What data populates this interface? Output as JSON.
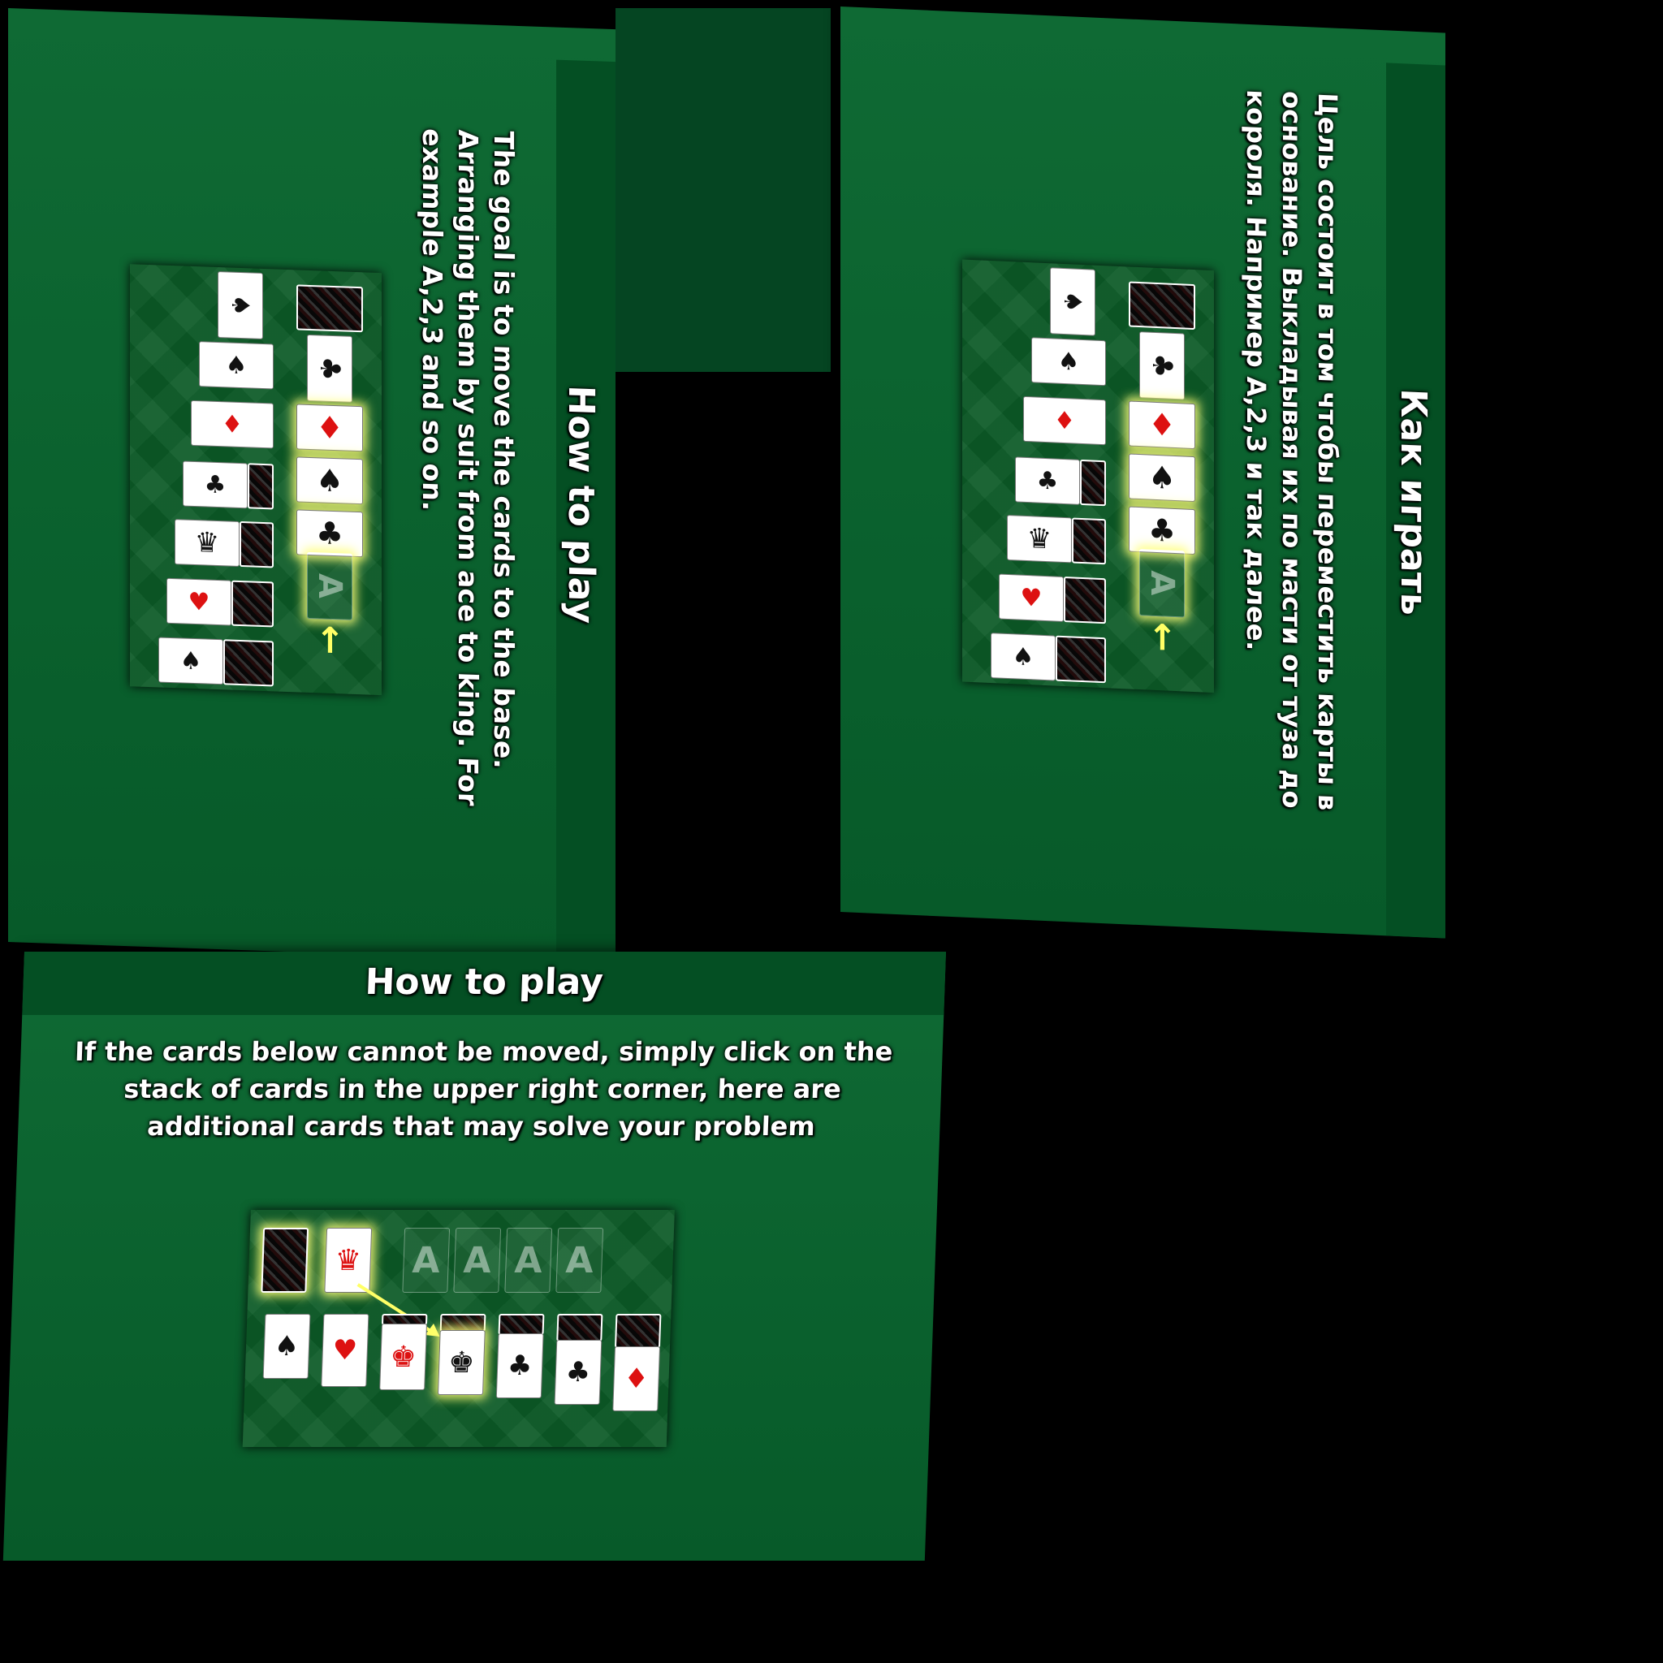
{
  "panel_en": {
    "title": "How to play",
    "body": "The goal is to move the cards to the base. Arranging them by suit from ace to king. For example A,2,3 and so on."
  },
  "panel_ru": {
    "title": "Как играть",
    "body": "Цель состоит в том чтобы переместить карты в основание. Выкладывая их по масти от туза до короля. Например А,2,3 и так далее."
  },
  "panel_stock": {
    "title": "How to play",
    "body": "If the cards below cannot be moved, simply click on the stack of cards in the upper right corner, here are additional cards that may solve your problem"
  },
  "illustration_vertical": {
    "empty_slot_label": "A",
    "arrow": "↑",
    "foundation": [
      {
        "glyph": "♦",
        "suit": "red"
      },
      {
        "glyph": "♠",
        "suit": "black"
      },
      {
        "glyph": "♣",
        "suit": "black"
      }
    ],
    "stock_top": {
      "glyph": "♣",
      "suit": "black"
    },
    "tableau": [
      {
        "glyph": "♠",
        "suit": "black"
      },
      {
        "glyph": "♠",
        "suit": "black"
      },
      {
        "glyph": "♦",
        "suit": "red"
      },
      {
        "glyph": "♣",
        "suit": "black"
      },
      {
        "glyph": "♛",
        "suit": "black"
      },
      {
        "glyph": "♥",
        "suit": "red"
      },
      {
        "glyph": "♠",
        "suit": "black"
      }
    ]
  },
  "illustration_horizontal": {
    "foundation_labels": [
      "A",
      "A",
      "A",
      "A"
    ],
    "waste": {
      "glyph": "♛",
      "suit": "red"
    },
    "tableau": [
      {
        "glyph": "♠",
        "suit": "black"
      },
      {
        "glyph": "♥",
        "suit": "red"
      },
      {
        "glyph": "♚",
        "suit": "red"
      },
      {
        "glyph": "♚",
        "suit": "black"
      },
      {
        "glyph": "♣",
        "suit": "black"
      },
      {
        "glyph": "♣",
        "suit": "black"
      },
      {
        "glyph": "♦",
        "suit": "red"
      }
    ]
  },
  "colors": {
    "felt": "#0b5a26",
    "panel": "#0f6a34",
    "strip": "#044f23",
    "highlight": "#ffff78",
    "arrow": "#ffff66"
  }
}
